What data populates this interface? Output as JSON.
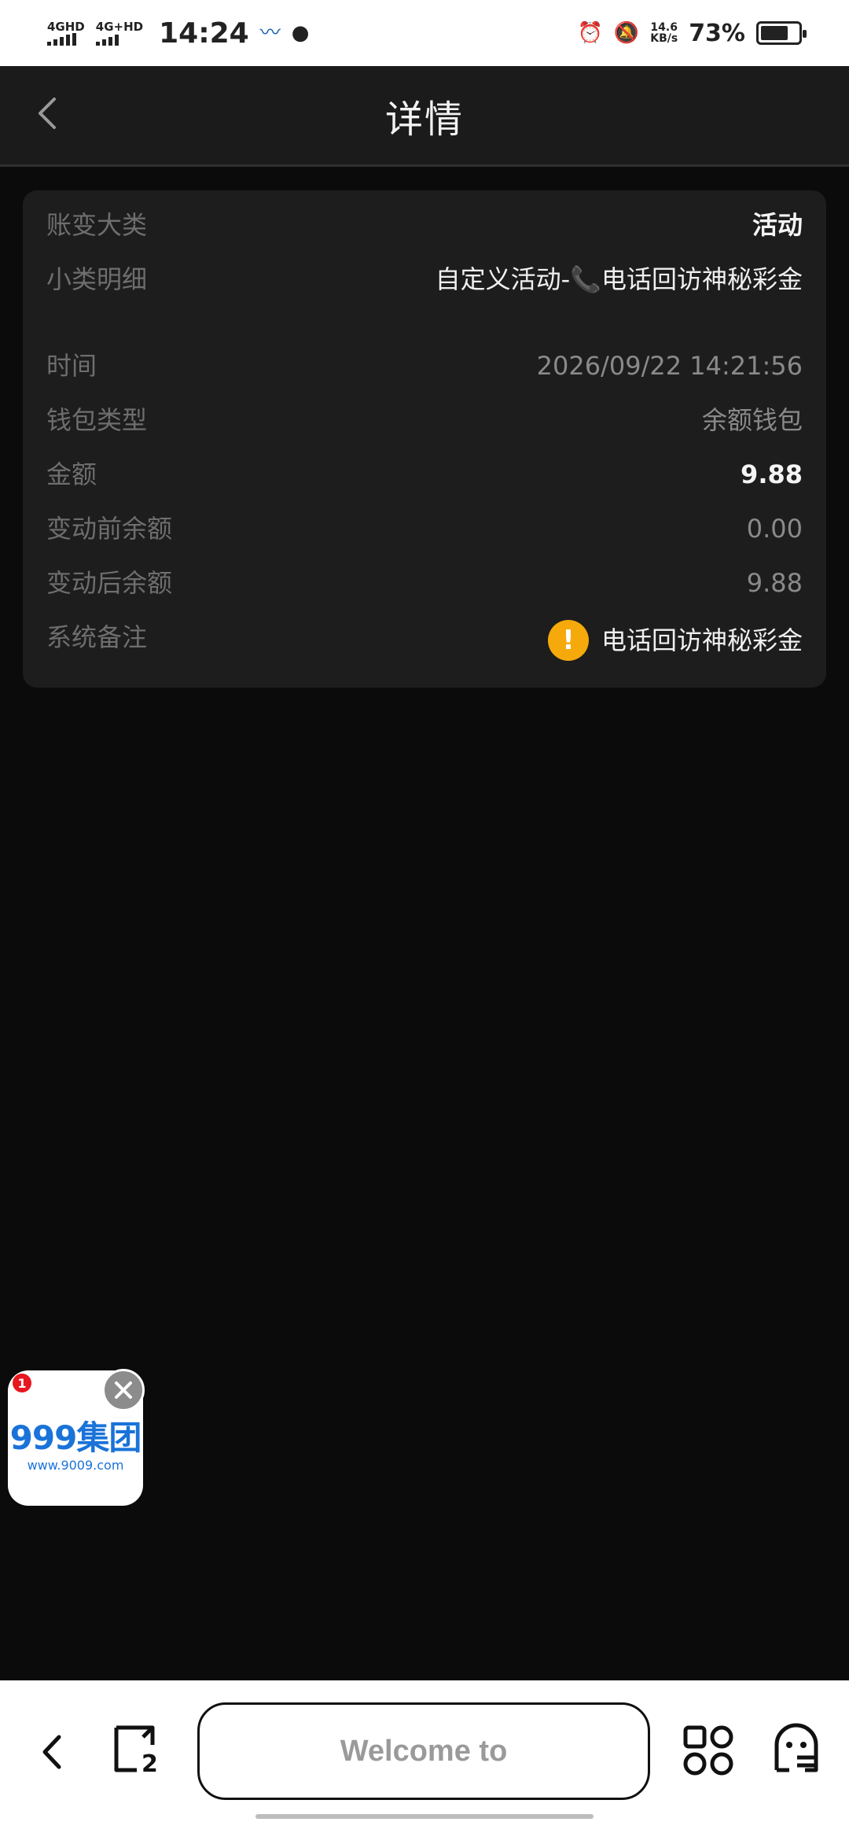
{
  "status_bar": {
    "sim1": "4GHD",
    "sim2": "4G+HD",
    "time": "14:24",
    "net_speed_value": "14.6",
    "net_speed_unit": "KB/s",
    "battery_percent": "73%",
    "battery_level": 0.73
  },
  "header": {
    "title": "详情"
  },
  "details": {
    "rows": [
      {
        "label": "账变大类",
        "value": "活动"
      },
      {
        "label": "小类明细",
        "value": "自定义活动-📞电话回访神秘彩金"
      },
      {
        "label": "时间",
        "value": "2026/09/22 14:21:56"
      },
      {
        "label": "钱包类型",
        "value": "余额钱包"
      },
      {
        "label": "金额",
        "value": "9.88"
      },
      {
        "label": "变动前余额",
        "value": "0.00"
      },
      {
        "label": "变动后余额",
        "value": "9.88"
      },
      {
        "label": "系统备注",
        "value": "电话回访神秘彩金"
      }
    ]
  },
  "float_ad": {
    "badge_count": "1",
    "logo_text": "999集团",
    "url_text": "www.9009.com"
  },
  "bottom_bar": {
    "address_text": "Welcome to",
    "tab_count": "2"
  },
  "colors": {
    "warning": "#f5a90a",
    "brand_blue": "#1a73d9",
    "badge_red": "#e8161f"
  }
}
